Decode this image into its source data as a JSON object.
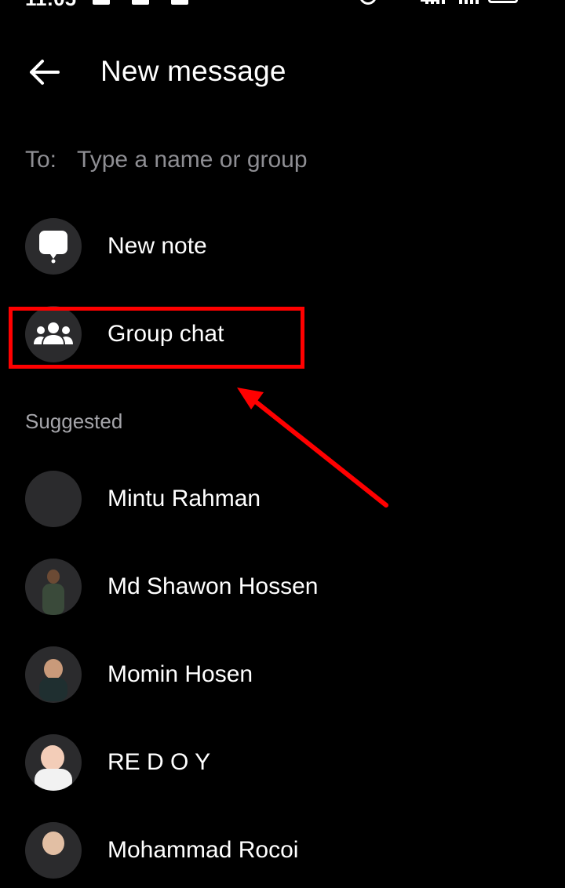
{
  "header": {
    "title": "New message"
  },
  "to_field": {
    "label": "To:",
    "placeholder": "Type a name or group",
    "value": ""
  },
  "actions": [
    {
      "label": "New note",
      "icon": "note-icon"
    },
    {
      "label": "Group chat",
      "icon": "group-icon"
    }
  ],
  "suggested": {
    "title": "Suggested",
    "contacts": [
      {
        "name": "Mintu Rahman"
      },
      {
        "name": "Md Shawon Hossen"
      },
      {
        "name": "Momin Hosen"
      },
      {
        "name": "RE  D O Y"
      },
      {
        "name": "Mohammad Rocoi"
      }
    ]
  },
  "colors": {
    "background": "#000000",
    "text_primary": "#ffffff",
    "text_secondary": "#8e8e93",
    "icon_circle": "#2b2b2d",
    "annotation_red": "#ff0000"
  }
}
